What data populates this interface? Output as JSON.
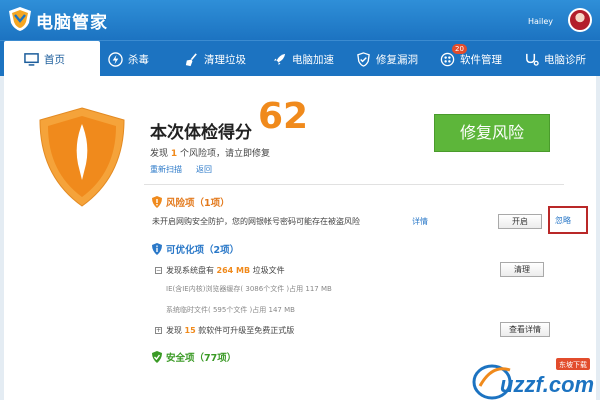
{
  "app": {
    "title": "电脑管家",
    "user": "Hailey"
  },
  "nav": [
    {
      "label": "首页",
      "icon": "monitor-icon"
    },
    {
      "label": "杀毒",
      "icon": "lightning-icon"
    },
    {
      "label": "清理垃圾",
      "icon": "broom-icon"
    },
    {
      "label": "电脑加速",
      "icon": "rocket-icon"
    },
    {
      "label": "修复漏洞",
      "icon": "shield-patch-icon"
    },
    {
      "label": "软件管理",
      "icon": "apps-icon",
      "badge": "20"
    },
    {
      "label": "电脑诊所",
      "icon": "stethoscope-icon"
    }
  ],
  "score": {
    "title": "本次体检得分",
    "value": "62",
    "summary_prefix": "发现",
    "risk_count": "1",
    "summary_suffix": "个风险项，请立即修复",
    "rescan": "重新扫描",
    "back": "返回"
  },
  "fix_button": "修复风险",
  "risk": {
    "title": "风险项（1项）",
    "text": "未开启网购安全防护，您的网银帐号密码可能存在被盗风险",
    "detail": "详情",
    "button": "开启",
    "ignore": "忽略"
  },
  "optimize": {
    "title": "可优化项（2项）",
    "junk_prefix": "发现系统盘有",
    "junk_size": "264 MB",
    "junk_suffix": "垃圾文件",
    "clean_button": "清理",
    "sub1": "IE(含IE内核)浏览器缓存( 3086个文件 )占用 117 MB",
    "sub2": "系统临时文件( 595个文件 )占用 147 MB",
    "soft_prefix": "发现",
    "soft_count": "15",
    "soft_suffix": "款软件可升级至免费正式版",
    "detail_button": "查看详情"
  },
  "safe": {
    "title": "安全项（77项）"
  },
  "watermark": {
    "text": "uzzf.com",
    "tag": "东坡下载"
  },
  "colors": {
    "title_bar": "#1c73c1",
    "accent_orange": "#f08a1c",
    "fix_green": "#5db63a",
    "highlight_red": "#b92828"
  }
}
